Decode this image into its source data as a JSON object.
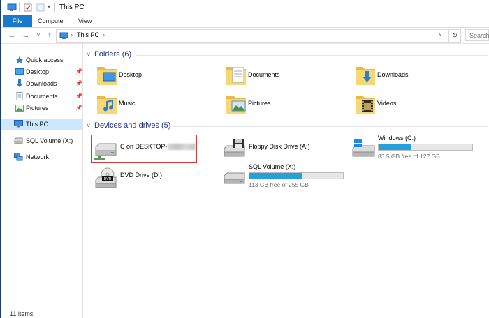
{
  "window": {
    "title": "This PC"
  },
  "ribbon": {
    "tabs": [
      "File",
      "Computer",
      "View"
    ]
  },
  "address": {
    "crumb": "This PC",
    "search_placeholder": "Search"
  },
  "sidebar": {
    "items": [
      {
        "label": "Quick access",
        "icon": "star-icon",
        "pinned": false
      },
      {
        "label": "Desktop",
        "icon": "desktop-folder-icon",
        "pinned": true
      },
      {
        "label": "Downloads",
        "icon": "download-arrow-icon",
        "pinned": true
      },
      {
        "label": "Documents",
        "icon": "document-icon",
        "pinned": true
      },
      {
        "label": "Pictures",
        "icon": "picture-icon",
        "pinned": true
      },
      {
        "label": "This PC",
        "icon": "computer-icon",
        "selected": true
      },
      {
        "label": "SQL Volume (X:)",
        "icon": "drive-icon"
      },
      {
        "label": "Network",
        "icon": "network-icon"
      }
    ]
  },
  "status": {
    "text": "11 items"
  },
  "folders": {
    "header": "Folders (6)",
    "items": [
      {
        "label": "Desktop",
        "icon": "desktop-folder-icon"
      },
      {
        "label": "Documents",
        "icon": "documents-folder-icon"
      },
      {
        "label": "Downloads",
        "icon": "downloads-folder-icon"
      },
      {
        "label": "Music",
        "icon": "music-folder-icon"
      },
      {
        "label": "Pictures",
        "icon": "pictures-folder-icon"
      },
      {
        "label": "Videos",
        "icon": "videos-folder-icon"
      }
    ]
  },
  "drives": {
    "header": "Devices and drives (5)",
    "items": [
      {
        "label": "C on DESKTOP-",
        "icon": "network-drive-icon"
      },
      {
        "label": "Floppy Disk Drive (A:)",
        "icon": "floppy-drive-icon"
      },
      {
        "label": "Windows (C:)",
        "icon": "windows-drive-icon",
        "free": "83.5 GB free of 127 GB",
        "used_fraction": 0.34
      },
      {
        "label": "DVD Drive (D:)",
        "icon": "dvd-drive-icon"
      },
      {
        "label": "SQL Volume (X:)",
        "icon": "hdd-icon",
        "free": "113 GB free of 255 GB",
        "used_fraction": 0.56
      }
    ]
  },
  "colors": {
    "accent": "#1979ca",
    "selection": "#cce8ff",
    "highlight_box": "#d43a3a",
    "usage_bar": "#26a0da",
    "folder_yellow": "#f8d775"
  }
}
